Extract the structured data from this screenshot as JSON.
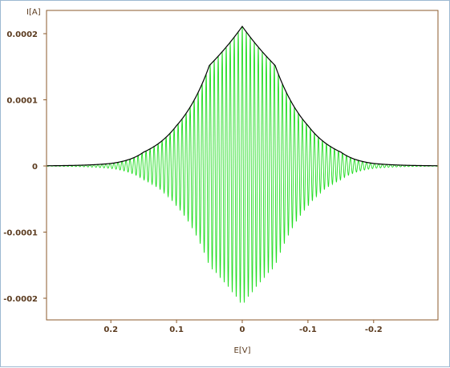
{
  "chart_data": {
    "type": "line",
    "xlabel": "E[V]",
    "ylabel": "I[A]",
    "xlim": [
      0.3,
      -0.3
    ],
    "ylim": [
      -0.00023,
      0.00024
    ],
    "x_ticks": [
      0.2,
      0.1,
      0,
      -0.1,
      -0.2
    ],
    "x_tick_labels": [
      "0.2",
      "0.1",
      "0",
      "-0.1",
      "-0.2"
    ],
    "y_ticks": [
      0.0002,
      0.0001,
      0,
      -0.0001,
      -0.0002
    ],
    "y_tick_labels": [
      "0.0002",
      "0.0001",
      "0",
      "-0.0001",
      "-0.0002"
    ],
    "grid": false,
    "series": [
      {
        "role": "oscillating-current",
        "color": "#22dd22",
        "style": "line",
        "x": [
          0.3,
          0.25,
          0.2,
          0.15,
          0.1,
          0.05,
          0.0,
          -0.05,
          -0.1,
          -0.15,
          -0.2,
          -0.25,
          -0.3
        ],
        "envelope_max": [
          3e-07,
          1e-06,
          3.8e-06,
          2.1e-05,
          6.1e-05,
          0.000152,
          0.000211,
          0.000152,
          6.1e-05,
          2.1e-05,
          3.8e-06,
          1e-06,
          3e-07
        ],
        "envelope_min": [
          -3e-07,
          -1e-06,
          -3.8e-06,
          -2.1e-05,
          -6.1e-05,
          -0.000152,
          -0.000211,
          -0.000152,
          -6.1e-05,
          -2.1e-05,
          -3.8e-06,
          -1e-06,
          -3e-07
        ],
        "oscillation_period_V": 0.0061
      },
      {
        "role": "upper-envelope",
        "color": "#000000",
        "style": "line",
        "x": [
          0.3,
          0.25,
          0.2,
          0.15,
          0.1,
          0.05,
          0.0,
          -0.05,
          -0.1,
          -0.15,
          -0.2,
          -0.25,
          -0.3
        ],
        "y": [
          3e-07,
          1e-06,
          3.8e-06,
          2.1e-05,
          6.1e-05,
          0.000152,
          0.000211,
          0.000152,
          6.1e-05,
          2.1e-05,
          3.8e-06,
          1e-06,
          3e-07
        ]
      }
    ]
  },
  "colors": {
    "axis": "#8b5a2b",
    "tick_label": "#5a3a1e",
    "frame_border": "#9db9d2",
    "plot_background": "#ffffff"
  }
}
